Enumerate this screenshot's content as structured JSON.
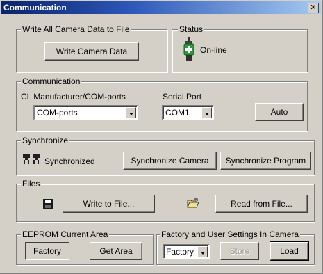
{
  "window": {
    "title": "Communication",
    "close_label": "✕"
  },
  "write_all": {
    "legend": "Write All Camera Data to File",
    "button_label": "Write Camera Data"
  },
  "status": {
    "legend": "Status",
    "text": "On-line",
    "icon": "connector-plug-icon",
    "icon_color": "#2e9b3c"
  },
  "communication": {
    "legend": "Communication",
    "manufacturer_label": "CL Manufacturer/COM-ports",
    "manufacturer_value": "COM-ports",
    "serial_label": "Serial Port",
    "serial_value": "COM1",
    "auto_label": "Auto"
  },
  "synchronize": {
    "legend": "Synchronize",
    "status_text": "Synchronized",
    "icon": "synchronized-connectors-icon",
    "sync_camera_label": "Synchronize Camera",
    "sync_program_label": "Synchronize Program"
  },
  "files": {
    "legend": "Files",
    "write_icon": "floppy-disk-icon",
    "write_label": "Write to File...",
    "read_icon": "open-folder-icon",
    "read_label": "Read from File..."
  },
  "eeprom": {
    "legend": "EEPROM Current Area",
    "value": "Factory",
    "get_area_label": "Get Area"
  },
  "factory_user": {
    "legend": "Factory and User Settings In Camera",
    "select_value": "Factory",
    "store_label": "Store",
    "load_label": "Load"
  }
}
